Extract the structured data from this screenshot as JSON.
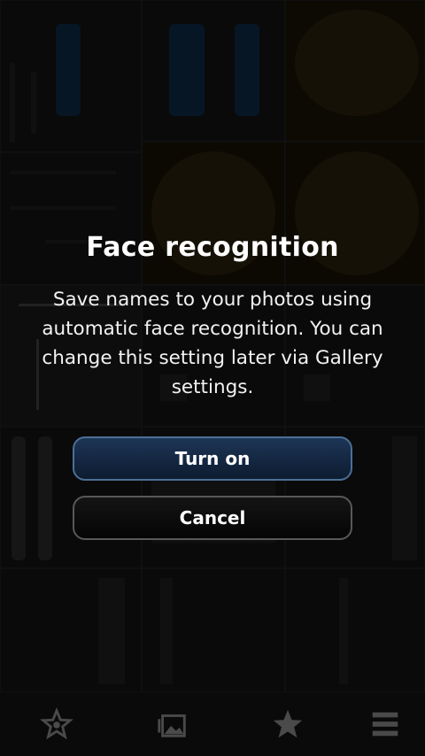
{
  "dialog": {
    "title": "Face recognition",
    "message": "Save names to your photos using automatic face recognition. You can change this setting later via Gallery settings.",
    "primary_label": "Turn on",
    "secondary_label": "Cancel"
  },
  "toolbar": {
    "icons": [
      "favorites-star-frame-icon",
      "gallery-photos-icon",
      "star-icon",
      "menu-icon"
    ]
  },
  "colors": {
    "primary_button_border": "#4c6f97",
    "primary_button_fill": "#0d1c30",
    "secondary_button_border": "#585858"
  }
}
